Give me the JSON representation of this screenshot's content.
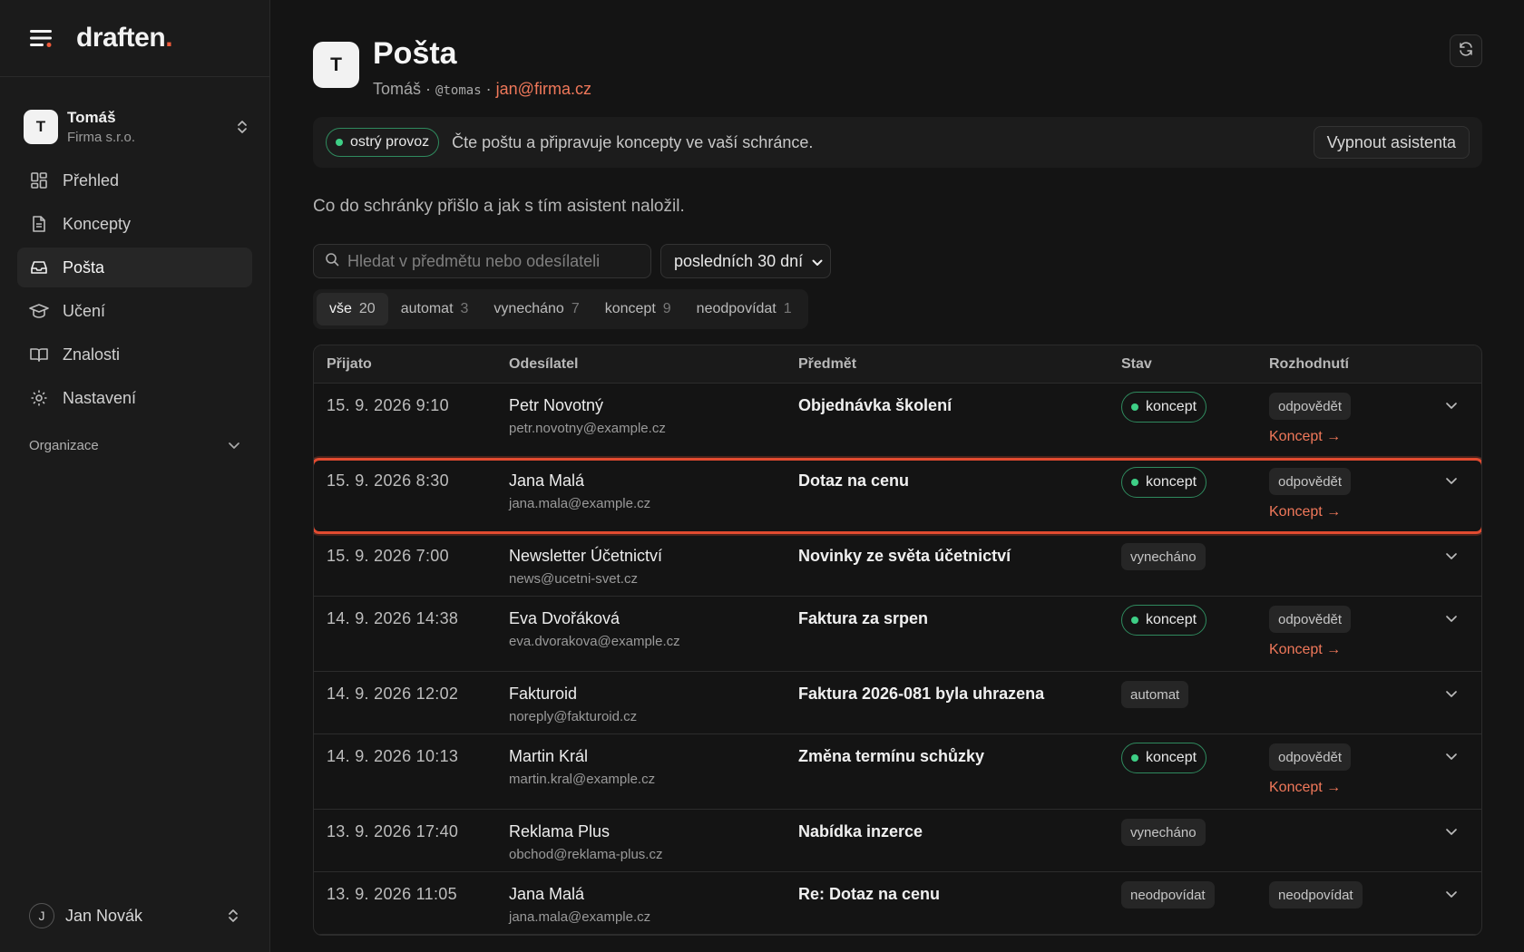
{
  "brand": {
    "name": "draften",
    "dot": "."
  },
  "org": {
    "avatar": "T",
    "name": "Tomáš",
    "company": "Firma s.r.o."
  },
  "nav": [
    {
      "label": "Přehled",
      "icon": "dashboard-icon"
    },
    {
      "label": "Koncepty",
      "icon": "document-icon"
    },
    {
      "label": "Pošta",
      "icon": "inbox-icon",
      "active": true
    },
    {
      "label": "Učení",
      "icon": "graduation-cap-icon"
    },
    {
      "label": "Znalosti",
      "icon": "book-icon"
    },
    {
      "label": "Nastavení",
      "icon": "gear-icon"
    }
  ],
  "section": {
    "label": "Organizace"
  },
  "user": {
    "avatar": "J",
    "name": "Jan Novák"
  },
  "page": {
    "avatar": "T",
    "title": "Pošta",
    "name": "Tomáš",
    "sep": "·",
    "handle": "@tomas",
    "email": "jan@firma.cz"
  },
  "banner": {
    "status": "ostrý provoz",
    "text": "Čte poštu a připravuje koncepty ve vaší schránce.",
    "button": "Vypnout asistenta"
  },
  "lead": "Co do schránky přišlo a jak s tím asistent naložil.",
  "search": {
    "placeholder": "Hledat v předmětu nebo odesílateli",
    "value": ""
  },
  "range": {
    "selected": "posledních 30 dní"
  },
  "tabs": [
    {
      "label": "vše",
      "count": "20",
      "active": true
    },
    {
      "label": "automat",
      "count": "3"
    },
    {
      "label": "vynecháno",
      "count": "7"
    },
    {
      "label": "koncept",
      "count": "9"
    },
    {
      "label": "neodpovídat",
      "count": "1"
    }
  ],
  "columns": {
    "received": "Přijato",
    "sender": "Odesílatel",
    "subject": "Předmět",
    "status": "Stav",
    "decision": "Rozhodnutí"
  },
  "rows": [
    {
      "received": "15. 9. 2026 9:10",
      "name": "Petr Novotný",
      "email": "petr.novotny@example.cz",
      "subject": "Objednávka školení",
      "status": "koncept",
      "status_kind": "pill",
      "decision": "odpovědět",
      "link": "Koncept →"
    },
    {
      "received": "15. 9. 2026 8:30",
      "name": "Jana Malá",
      "email": "jana.mala@example.cz",
      "subject": "Dotaz na cenu",
      "status": "koncept",
      "status_kind": "pill",
      "decision": "odpovědět",
      "link": "Koncept →",
      "highlight": true
    },
    {
      "received": "15. 9. 2026 7:00",
      "name": "Newsletter Účetnictví",
      "email": "news@ucetni-svet.cz",
      "subject": "Novinky ze světa účetnictví",
      "status": "vynecháno",
      "status_kind": "tag"
    },
    {
      "received": "14. 9. 2026 14:38",
      "name": "Eva Dvořáková",
      "email": "eva.dvorakova@example.cz",
      "subject": "Faktura za srpen",
      "status": "koncept",
      "status_kind": "pill",
      "decision": "odpovědět",
      "link": "Koncept →"
    },
    {
      "received": "14. 9. 2026 12:02",
      "name": "Fakturoid",
      "email": "noreply@fakturoid.cz",
      "subject": "Faktura 2026-081 byla uhrazena",
      "status": "automat",
      "status_kind": "tag"
    },
    {
      "received": "14. 9. 2026 10:13",
      "name": "Martin Král",
      "email": "martin.kral@example.cz",
      "subject": "Změna termínu schůzky",
      "status": "koncept",
      "status_kind": "pill",
      "decision": "odpovědět",
      "link": "Koncept →"
    },
    {
      "received": "13. 9. 2026 17:40",
      "name": "Reklama Plus",
      "email": "obchod@reklama-plus.cz",
      "subject": "Nabídka inzerce",
      "status": "vynecháno",
      "status_kind": "tag"
    },
    {
      "received": "13. 9. 2026 11:05",
      "name": "Jana Malá",
      "email": "jana.mala@example.cz",
      "subject": "Re: Dotaz na cenu",
      "status": "neodpovídat",
      "status_kind": "tag",
      "decision": "neodpovídat"
    }
  ]
}
